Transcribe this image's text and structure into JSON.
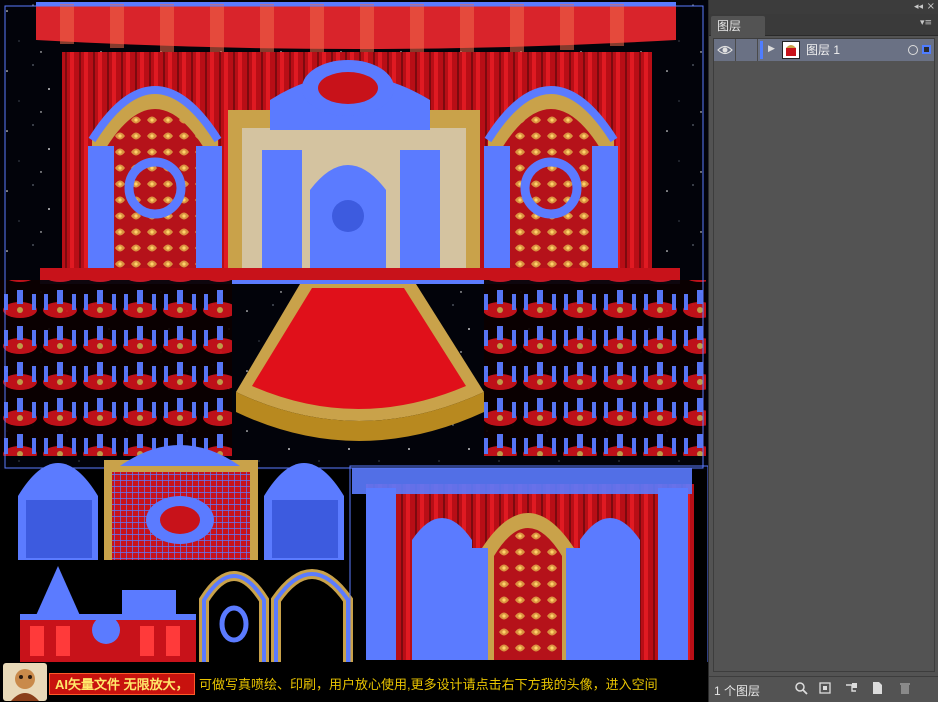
{
  "caption": {
    "badge": "AI矢量文件 无限放大，",
    "text": "可做写真喷绘、印刷，用户放心使用,更多设计请点击右下方我的头像，进入空间"
  },
  "panel": {
    "tab_label": "图层",
    "collapse_icon": "double-chevron-left-icon",
    "menu_icon": "panel-menu-icon",
    "layers": [
      {
        "name": "图层 1",
        "visible": true,
        "expanded": false,
        "selected": true
      }
    ],
    "footer": {
      "count": "1 个图层",
      "buttons": [
        "locate-object-icon",
        "make-clipping-mask-icon",
        "create-sublayer-icon",
        "new-layer-icon",
        "delete-layer-icon"
      ]
    }
  },
  "colors": {
    "selection": "#5b7bff",
    "stage_red": "#c8121a",
    "gold": "#c9a24a",
    "panel_bg": "#535353"
  }
}
